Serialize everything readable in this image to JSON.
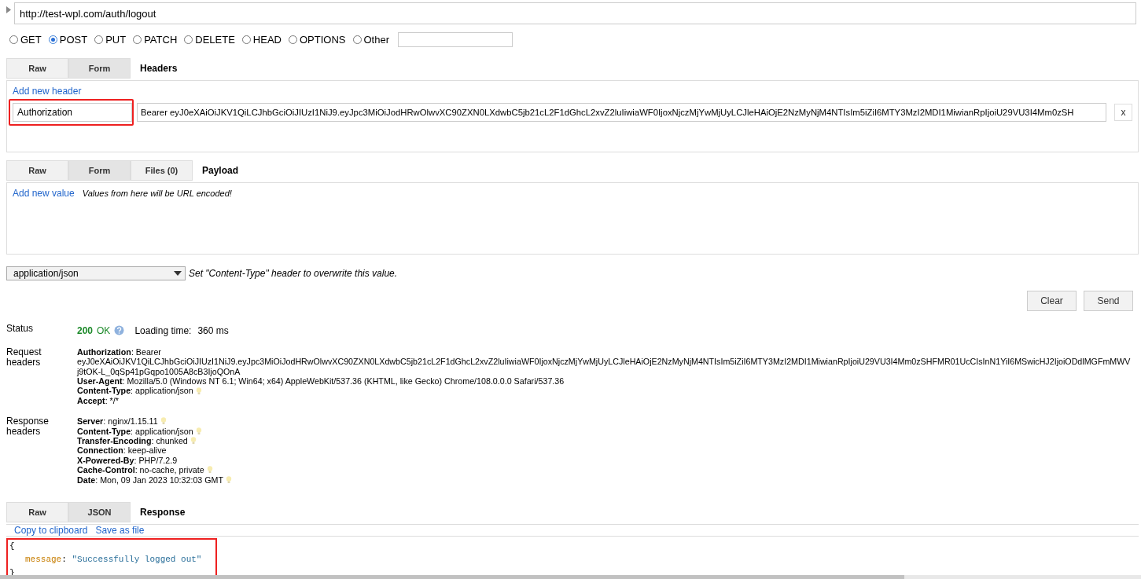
{
  "url": "http://test-wpl.com/auth/logout",
  "methods": [
    {
      "label": "GET",
      "selected": false
    },
    {
      "label": "POST",
      "selected": true
    },
    {
      "label": "PUT",
      "selected": false
    },
    {
      "label": "PATCH",
      "selected": false
    },
    {
      "label": "DELETE",
      "selected": false
    },
    {
      "label": "HEAD",
      "selected": false
    },
    {
      "label": "OPTIONS",
      "selected": false
    },
    {
      "label": "Other",
      "selected": false
    }
  ],
  "headers_section": {
    "tabs": [
      {
        "label": "Raw",
        "selected": false
      },
      {
        "label": "Form",
        "selected": true
      }
    ],
    "title": "Headers",
    "add_link": "Add new header",
    "rows": [
      {
        "name": "Authorization",
        "value": "Bearer eyJ0eXAiOiJKV1QiLCJhbGciOiJIUzI1NiJ9.eyJpc3MiOiJodHRwOlwvXC90ZXN0LXdwbC5jb21cL2F1dGhcL2xvZ2luIiwiaWF0IjoxNjczMjYwMjUyLCJleHAiOjE2NzMyNjM4NTIsIm5iZiI6MTY3MzI2MDI1MiwianRpIjoiU29VU3I4Mm0zSH",
        "remove": "x",
        "highlighted": true
      }
    ]
  },
  "payload_section": {
    "tabs": [
      {
        "label": "Raw",
        "selected": false
      },
      {
        "label": "Form",
        "selected": true
      },
      {
        "label": "Files (0)",
        "selected": false
      }
    ],
    "title": "Payload",
    "add_link": "Add new value",
    "note": "Values from here will be URL encoded!"
  },
  "content_type": {
    "value": "application/json",
    "note": "Set \"Content-Type\" header to overwrite this value."
  },
  "buttons": [
    "Clear",
    "Send"
  ],
  "status": {
    "label": "Status",
    "code": "200",
    "text": "OK",
    "loading_label": "Loading time:",
    "loading_value": "360 ms"
  },
  "request_headers": {
    "label": "Request headers",
    "separator": ":",
    "items": [
      {
        "name": "Authorization",
        "value": "Bearer",
        "more_lines": [
          "eyJ0eXAiOiJKV1QiLCJhbGciOiJIUzI1NiJ9.eyJpc3MiOiJodHRwOlwvXC90ZXN0LXdwbC5jb21cL2F1dGhcL2xvZ2luIiwiaWF0IjoxNjczMjYwMjUyLCJleHAiOjE2NzMyNjM4NTIsIm5iZiI6MTY3MzI2MDI1MiwianRpIjoiU29VU3I4Mm0zSHFMR01UcCIsInN1YiI6MSwicHJ2IjoiODdlMGFmMWV",
          "j9tOK-L_0qSp41pGqpo1005A8cB3IjoQOnA"
        ],
        "hint": false
      },
      {
        "name": "User-Agent",
        "value": "Mozilla/5.0 (Windows NT 6.1; Win64; x64) AppleWebKit/537.36 (KHTML, like Gecko) Chrome/108.0.0.0 Safari/537.36",
        "hint": false
      },
      {
        "name": "Content-Type",
        "value": "application/json",
        "hint": true
      },
      {
        "name": "Accept",
        "value": "*/*",
        "hint": false
      }
    ]
  },
  "response_headers": {
    "label": "Response headers",
    "separator": ":",
    "items": [
      {
        "name": "Server",
        "value": "nginx/1.15.11",
        "hint": true
      },
      {
        "name": "Content-Type",
        "value": "application/json",
        "hint": true
      },
      {
        "name": "Transfer-Encoding",
        "value": "chunked",
        "hint": true
      },
      {
        "name": "Connection",
        "value": "keep-alive",
        "hint": false
      },
      {
        "name": "X-Powered-By",
        "value": "PHP/7.2.9",
        "hint": false
      },
      {
        "name": "Cache-Control",
        "value": "no-cache, private",
        "hint": true
      },
      {
        "name": "Date",
        "value": "Mon, 09 Jan 2023 10:32:03 GMT",
        "hint": true
      }
    ]
  },
  "response_section": {
    "tabs": [
      {
        "label": "Raw",
        "selected": false
      },
      {
        "label": "JSON",
        "selected": true
      }
    ],
    "title": "Response",
    "links": [
      "Copy to clipboard",
      "Save as file"
    ],
    "body": {
      "open": "{",
      "key": "message",
      "separator": ":",
      "value": "\"Successfully logged out\"",
      "close": "}",
      "highlighted": true
    }
  }
}
